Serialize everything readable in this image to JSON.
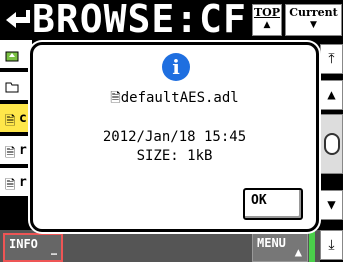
{
  "header": {
    "title": "BROWSE:CF",
    "top_button": "TOP",
    "current_button": "Current"
  },
  "list": {
    "rows": [
      {
        "icon": "up-folder-icon",
        "label": ""
      },
      {
        "icon": "folder-icon",
        "label": ""
      },
      {
        "icon": "file-icon",
        "label": "c",
        "selected": true
      },
      {
        "icon": "file-icon",
        "label": "r"
      },
      {
        "icon": "file-icon",
        "label": "r"
      }
    ]
  },
  "dialog": {
    "icon": "info-icon",
    "filename": "defaultAES.adl",
    "date": "2012/Jan/18 15:45",
    "size": "SIZE: 1kB",
    "ok_label": "OK"
  },
  "bottom": {
    "info_label": "INFO",
    "menu_label": "MENU"
  },
  "colors": {
    "selected_row": "#ffe74a",
    "info_icon": "#1f6fe0",
    "accent_green": "#4ad04a",
    "info_border": "#ee5555"
  }
}
